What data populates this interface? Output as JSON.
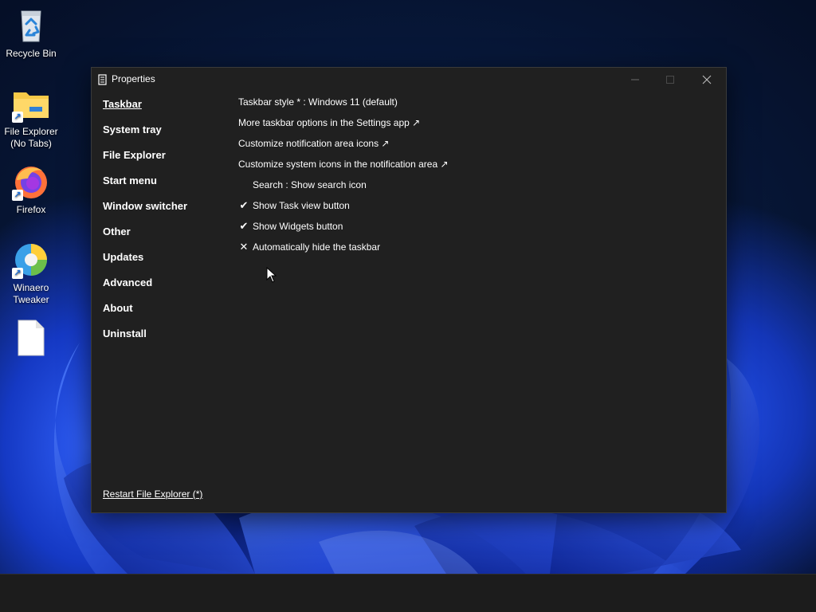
{
  "desktop": {
    "icons": [
      {
        "label": "Recycle Bin",
        "icon": "recycle-bin-icon"
      },
      {
        "label": "File Explorer\n(No Tabs)",
        "icon": "folder-icon"
      },
      {
        "label": "Firefox",
        "icon": "firefox-icon"
      },
      {
        "label": "Winaero\nTweaker",
        "icon": "winaero-tweaker-icon"
      },
      {
        "label": "",
        "icon": "blank-file-icon"
      }
    ]
  },
  "window": {
    "title": "Properties",
    "controls": {
      "minimize": "minimize-icon",
      "maximize": "maximize-icon",
      "close": "close-icon"
    }
  },
  "nav": {
    "items": [
      {
        "label": "Taskbar",
        "active": true
      },
      {
        "label": "System tray"
      },
      {
        "label": "File Explorer"
      },
      {
        "label": "Start menu"
      },
      {
        "label": "Window switcher"
      },
      {
        "label": "Other"
      },
      {
        "label": "Updates"
      },
      {
        "label": "Advanced"
      },
      {
        "label": "About"
      },
      {
        "label": "Uninstall"
      }
    ]
  },
  "content": {
    "rows": [
      {
        "label": "Taskbar style * : Windows 11 (default)",
        "mark": ""
      },
      {
        "label": "More taskbar options in the Settings app ↗",
        "mark": ""
      },
      {
        "label": "Customize notification area icons ↗",
        "mark": ""
      },
      {
        "label": "Customize system icons in the notification area ↗",
        "mark": ""
      },
      {
        "label": "Search : Show search icon",
        "mark": ""
      },
      {
        "label": "Show Task view button",
        "mark": "✔"
      },
      {
        "label": "Show Widgets button",
        "mark": "✔"
      },
      {
        "label": "Automatically hide the taskbar",
        "mark": "✕"
      }
    ]
  },
  "footer": {
    "restart_label": "Restart File Explorer (*)"
  },
  "colors": {
    "window_bg": "#202020",
    "text": "#ffffff",
    "taskbar_bg": "#1c1c1c"
  }
}
